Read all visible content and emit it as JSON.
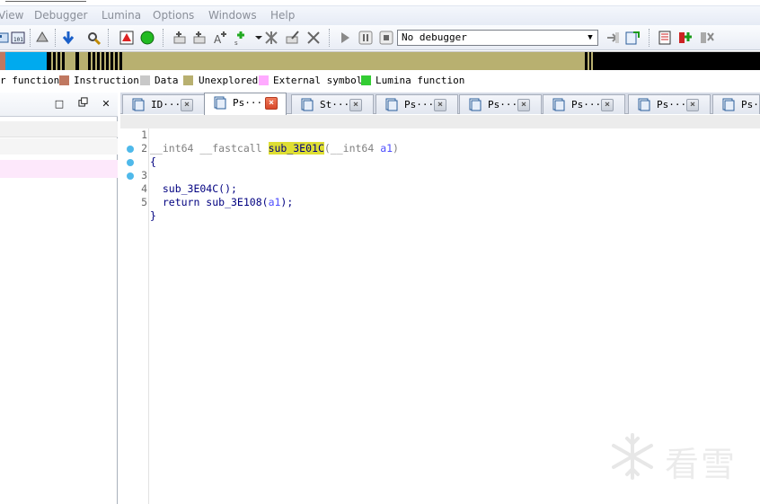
{
  "menu": {
    "view": "View",
    "debugger": "Debugger",
    "lumina": "Lumina",
    "options": "Options",
    "windows": "Windows",
    "help": "Help"
  },
  "toolbar": {
    "debugger_select": "No debugger"
  },
  "legend": {
    "items": [
      {
        "label": "r function",
        "color": "#00aaee"
      },
      {
        "label": "Instruction",
        "color": "#c07860"
      },
      {
        "label": "Data",
        "color": "#c8c8c8"
      },
      {
        "label": "Unexplored",
        "color": "#b8b070"
      },
      {
        "label": "External symbol",
        "color": "#ffaaff"
      },
      {
        "label": "Lumina function",
        "color": "#33cc33"
      }
    ]
  },
  "left_panel": {
    "minimize": "□",
    "restore": "🗗",
    "close": "✕"
  },
  "tabs": [
    {
      "label": "ID···",
      "active": false
    },
    {
      "label": "Ps···",
      "active": true
    },
    {
      "label": "St···",
      "active": false
    },
    {
      "label": "Ps···",
      "active": false
    },
    {
      "label": "Ps···",
      "active": false
    },
    {
      "label": "Ps···",
      "active": false
    },
    {
      "label": "Ps···",
      "active": false
    },
    {
      "label": "Ps···",
      "active": false
    }
  ],
  "code": {
    "lines": [
      {
        "num": "1",
        "tokens": {
          "t1": "__int64 __fastcall ",
          "fname": "sub_3E01C",
          "t2": "(__int64 ",
          "arg": "a1",
          "t3": ")"
        }
      },
      {
        "num": "2",
        "text": "{"
      },
      {
        "num": "3",
        "text": "  sub_3E04C();"
      },
      {
        "num": "4",
        "text_pre": "  return sub_3E108(",
        "arg": "a1",
        "text_post": ");"
      },
      {
        "num": "5",
        "text": "}"
      }
    ]
  },
  "watermark": {
    "text": "看雪"
  }
}
